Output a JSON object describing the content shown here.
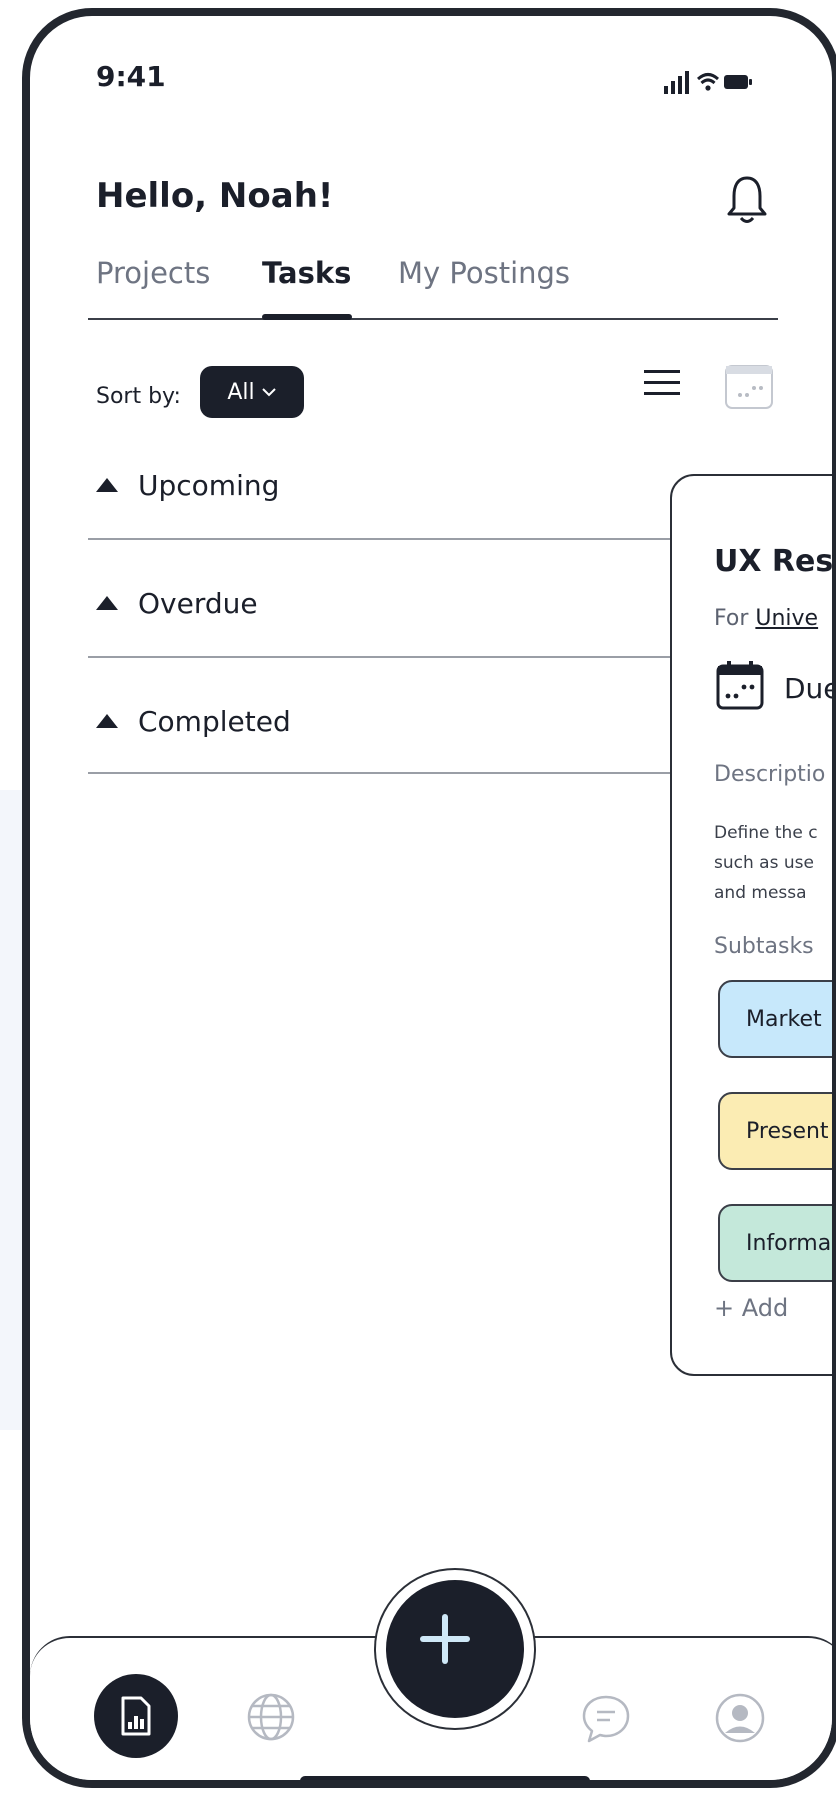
{
  "status": {
    "time": "9:41"
  },
  "header": {
    "greeting": "Hello, Noah!"
  },
  "tabs": [
    {
      "label": "Projects",
      "active": false
    },
    {
      "label": "Tasks",
      "active": true
    },
    {
      "label": "My Postings",
      "active": false
    }
  ],
  "sort": {
    "label": "Sort by:",
    "value": "All"
  },
  "sections": [
    {
      "label": "Upcoming"
    },
    {
      "label": "Overdue"
    },
    {
      "label": "Completed"
    }
  ],
  "card": {
    "title": "UX Rese",
    "for_prefix": "For ",
    "for_link": "Unive",
    "due": "Due",
    "description_label": "Descriptio",
    "description": "Define the c\nsuch as use\nand messa",
    "subtasks_label": "Subtasks",
    "subtasks": [
      {
        "label": "Market",
        "color": "#c7e8fb"
      },
      {
        "label": "Present",
        "color": "#fbecb3"
      },
      {
        "label": "Informa",
        "color": "#c4e8da"
      }
    ],
    "add_label": "+ Add"
  },
  "nav": {
    "items": [
      "reports-icon",
      "globe-icon",
      "add-icon",
      "chat-icon",
      "profile-icon"
    ],
    "active": "reports-icon"
  },
  "colors": {
    "primary": "#1b1f2a",
    "muted": "#6e7482"
  }
}
